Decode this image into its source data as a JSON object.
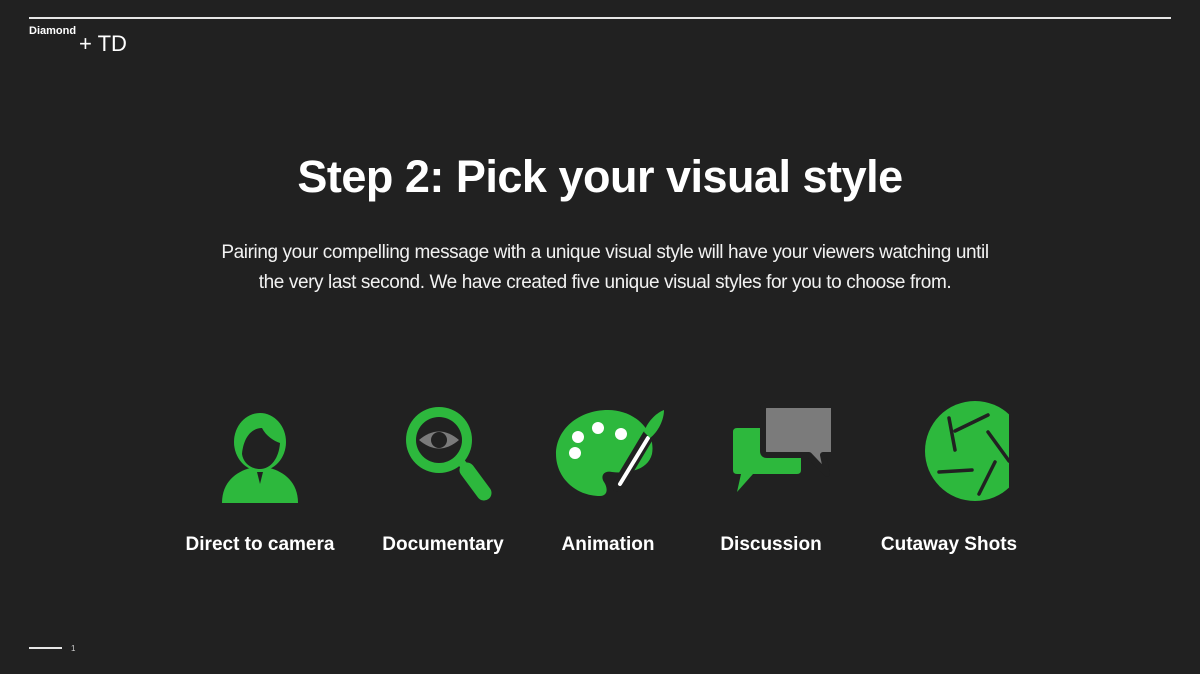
{
  "header": {
    "brand_primary": "Diamond",
    "brand_secondary": "+ TD"
  },
  "slide": {
    "title": "Step 2: Pick your visual style",
    "intro_line1": "Pairing your compelling message with a unique visual style will have your viewers watching until",
    "intro_line2": "the very last second. We have created five unique visual styles for you to choose from."
  },
  "styles": [
    {
      "label": "Direct to camera",
      "icon": "person-icon"
    },
    {
      "label": "Documentary",
      "icon": "magnifier-eye-icon"
    },
    {
      "label": "Animation",
      "icon": "paint-palette-icon"
    },
    {
      "label": "Discussion",
      "icon": "chat-bubbles-icon"
    },
    {
      "label": "Cutaway Shots",
      "icon": "camera-aperture-icon"
    }
  ],
  "footer": {
    "page_number": "1"
  },
  "colors": {
    "background": "#212121",
    "accent_green": "#2db83d",
    "icon_gray": "#7b7b7b",
    "text": "#ffffff"
  }
}
